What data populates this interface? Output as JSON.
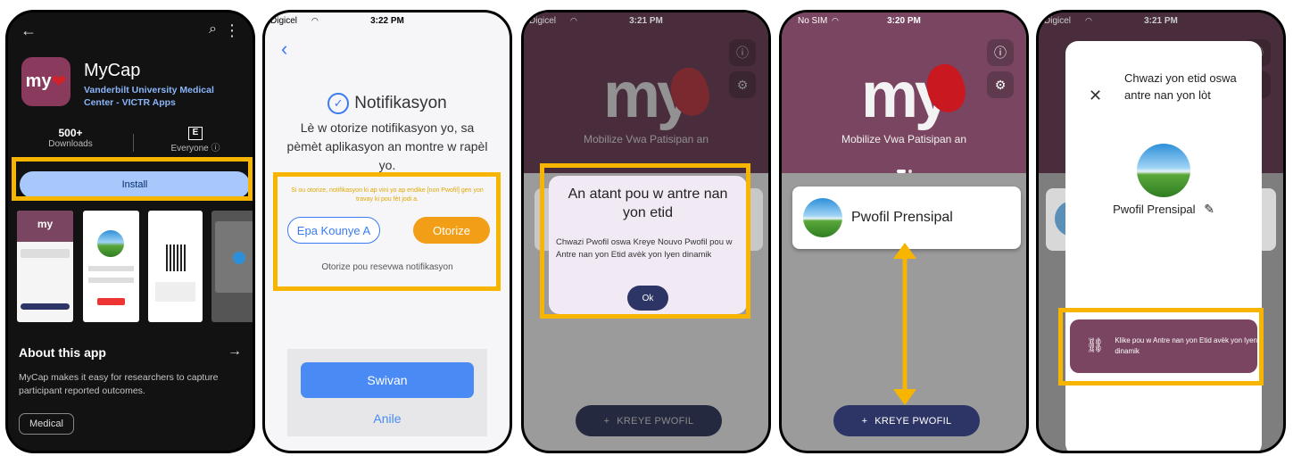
{
  "colors": {
    "highlight": "#f7b500",
    "mycap_purple": "#7a4561",
    "navy_button": "#2d3566",
    "ios_blue": "#4a8af4",
    "orange": "#f29e16",
    "playstore_button": "#a8c7fa"
  },
  "screen1": {
    "app_logo": "my",
    "app_name": "MyCap",
    "developer": "Vanderbilt University Medical Center - VICTR Apps",
    "downloads_count": "500+",
    "downloads_label": "Downloads",
    "rating_icon": "E",
    "rating_label": "Everyone ⓘ",
    "install_label": "Install",
    "about_title": "About this app",
    "about_desc": "MyCap makes it easy for researchers to capture participant reported outcomes.",
    "category_chip": "Medical"
  },
  "screen2": {
    "title": "Notifikasyon",
    "body": "Lè w otorize notifikasyon yo, sa pèmèt aplikasyon an montre w rapèl yo.",
    "small_text": "Si ou otorize, notifikasyon ki ap vini yo ap endike [non Pwofil] gen yon travay ki pou fèt jodi a.",
    "not_now_label": "Epa Kounye A",
    "authorize_label": "Otorize",
    "receive_label": "Otorize pou resevwa notifikasyon",
    "next_label": "Swivan",
    "cancel_label": "Anile",
    "status_time": "3:22 PM",
    "status_carrier": "Digicel"
  },
  "screen3": {
    "status_time": "3:21 PM",
    "status_carrier": "Digicel",
    "logo_text": "my",
    "tagline": "Mobilize Vwa Patisipan an",
    "dialog_title": "An atant pou w antre nan yon etid",
    "dialog_body": "Chwazi Pwofil oswa Kreye Nouvo Pwofil pou w Antre nan yon Etid avèk yon lyen dinamik",
    "ok_label": "Ok",
    "create_label": "KREYE PWOFIL"
  },
  "screen4": {
    "status_time": "3:20 PM",
    "status_carrier": "No SIM",
    "logo_text": "my",
    "tagline": "Mobilize Vwa Patisipan an",
    "profile_label": "Pwofil Prensipal",
    "create_label": "KREYE PWOFIL"
  },
  "screen5": {
    "status_time": "3:21 PM",
    "status_carrier": "Digicel",
    "title": "Chwazi yon etid oswa antre nan yon lòt",
    "profile_name": "Pwofil Prensipal",
    "link_button": "Klike pou w Antre nan yon Etid avèk yon lyen dinamik"
  }
}
